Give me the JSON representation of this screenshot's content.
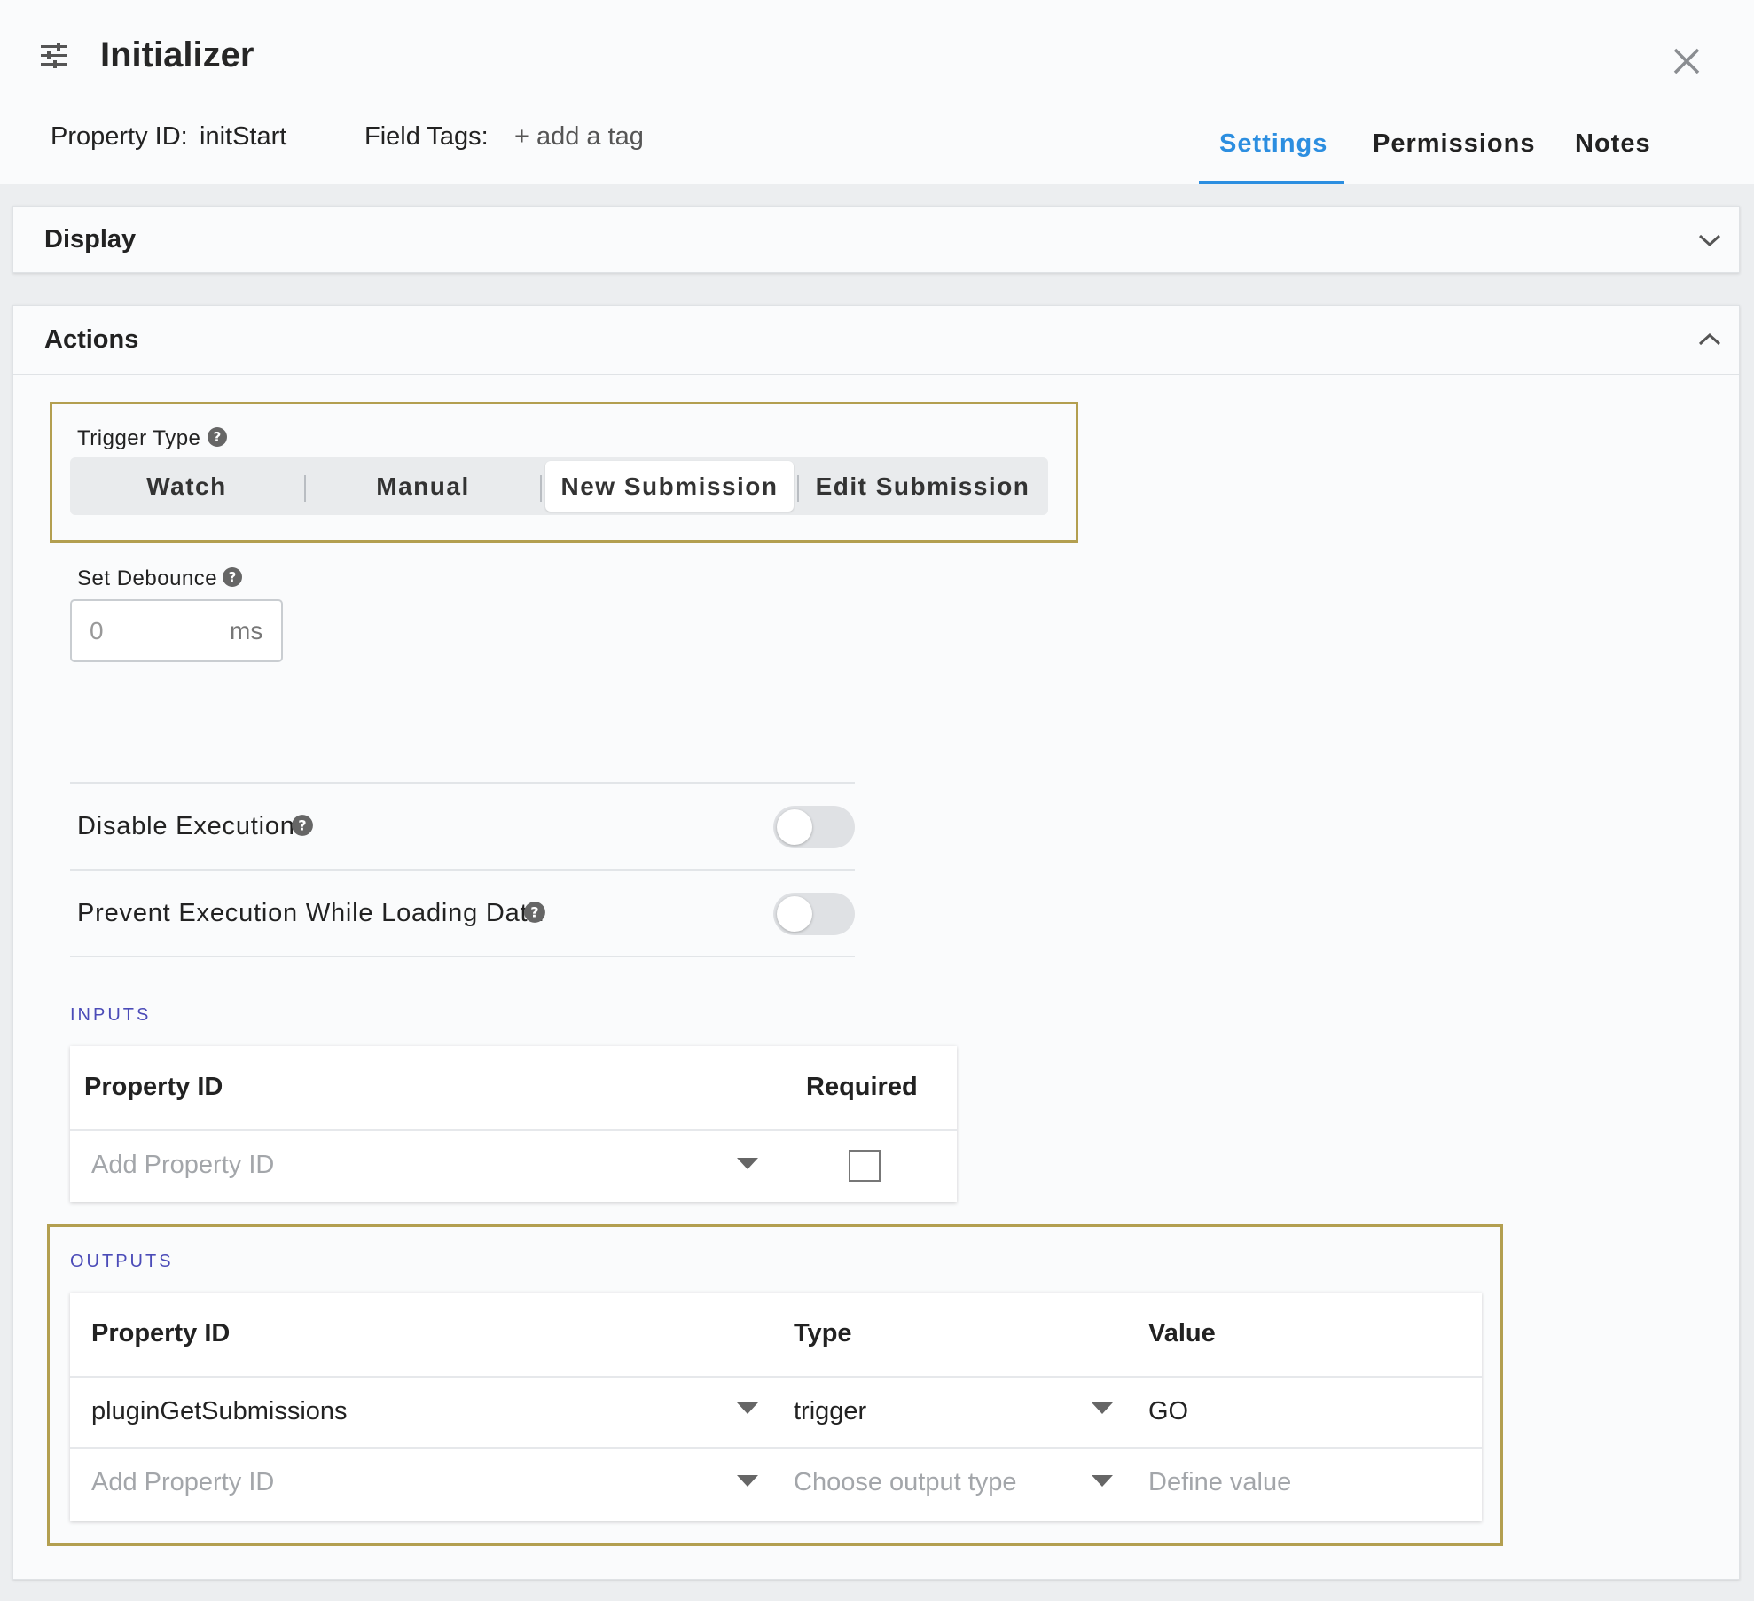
{
  "header": {
    "title": "Initializer",
    "property_id_label": "Property ID:",
    "property_id_value": "initStart",
    "field_tags_label": "Field Tags:",
    "add_tag": "+ add a tag",
    "tabs": [
      {
        "label": "Settings",
        "active": true
      },
      {
        "label": "Permissions",
        "active": false
      },
      {
        "label": "Notes",
        "active": false
      }
    ]
  },
  "display_panel": {
    "title": "Display",
    "expanded": false
  },
  "actions_panel": {
    "title": "Actions",
    "expanded": true,
    "trigger_type": {
      "label": "Trigger Type",
      "options": [
        "Watch",
        "Manual",
        "New Submission",
        "Edit Submission"
      ],
      "selected": "New Submission"
    },
    "debounce": {
      "label": "Set Debounce",
      "value": "0",
      "unit": "ms"
    },
    "disable_execution": {
      "label": "Disable Execution",
      "on": false
    },
    "prevent_execution": {
      "label": "Prevent Execution While Loading Data",
      "on": false
    },
    "inputs": {
      "caption": "INPUTS",
      "headers": [
        "Property ID",
        "Required"
      ],
      "new_row_placeholder": "Add Property ID",
      "required_checked": false
    },
    "outputs": {
      "caption": "OUTPUTS",
      "headers": [
        "Property ID",
        "Type",
        "Value"
      ],
      "rows": [
        {
          "property_id": "pluginGetSubmissions",
          "type": "trigger",
          "value": "GO"
        }
      ],
      "new_row": {
        "property_id_placeholder": "Add Property ID",
        "type_placeholder": "Choose output type",
        "value_placeholder": "Define value"
      }
    }
  },
  "colors": {
    "accent": "#2c8ee0",
    "highlight_border": "#b39f50",
    "section_caption": "#4b4bb8"
  },
  "icons": [
    "sliders-icon",
    "close-icon",
    "chevron-down-icon",
    "chevron-up-icon",
    "help-icon",
    "caret-down-icon"
  ]
}
